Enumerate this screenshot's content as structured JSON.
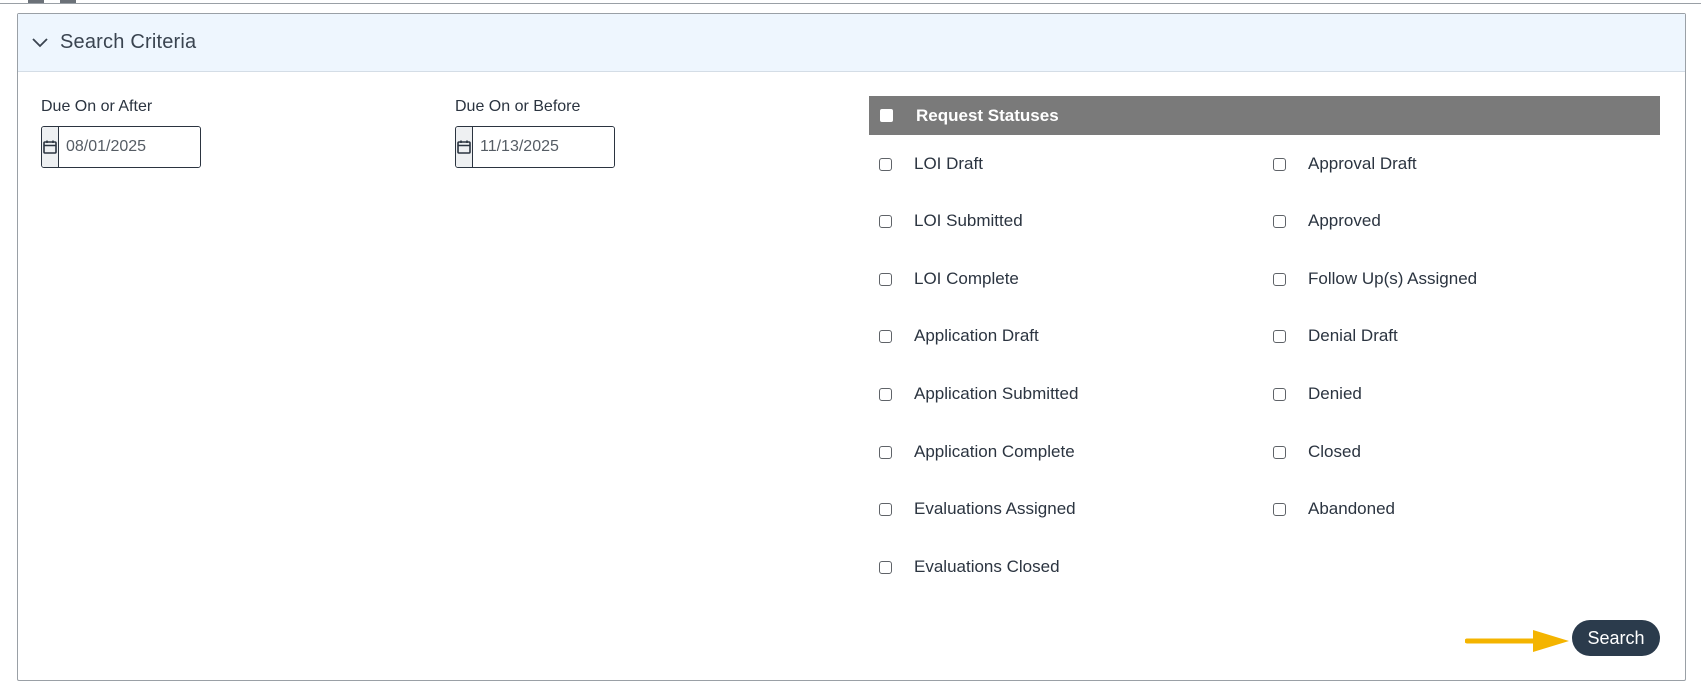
{
  "panel": {
    "title": "Search Criteria"
  },
  "dates": {
    "after": {
      "label": "Due On or After",
      "value": "08/01/2025"
    },
    "before": {
      "label": "Due On or Before",
      "value": "11/13/2025"
    }
  },
  "statuses": {
    "header": "Request Statuses",
    "left": [
      "LOI Draft",
      "LOI Submitted",
      "LOI Complete",
      "Application Draft",
      "Application Submitted",
      "Application Complete",
      "Evaluations Assigned",
      "Evaluations Closed"
    ],
    "right": [
      "Approval Draft",
      "Approved",
      "Follow Up(s) Assigned",
      "Denial Draft",
      "Denied",
      "Closed",
      "Abandoned"
    ]
  },
  "actions": {
    "search_label": "Search"
  },
  "colors": {
    "header_bg": "#7a7a7a",
    "panel_header_bg": "#eef6fe",
    "search_button_bg": "#2b3b4c",
    "arrow": "#f4b400"
  }
}
